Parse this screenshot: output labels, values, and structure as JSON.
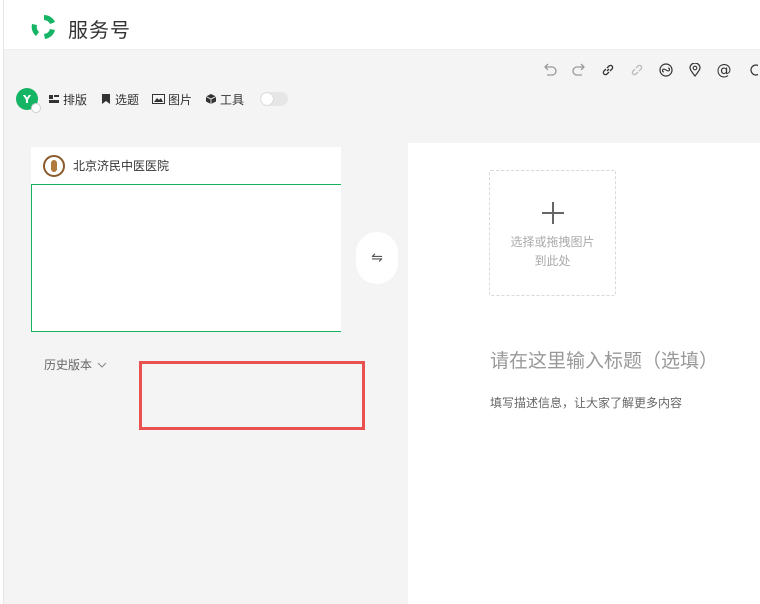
{
  "app": {
    "brand": "服务号",
    "brand_color": "#16b465"
  },
  "toolbar": {
    "icons": [
      "undo-icon",
      "redo-icon",
      "link-icon",
      "unlink-icon",
      "mini-program-icon",
      "location-icon",
      "mention-icon",
      "more-icon"
    ],
    "avatar_letter": "Y",
    "tools": [
      {
        "label": "排版",
        "icon": "layout-icon"
      },
      {
        "label": "选题",
        "icon": "bookmark-icon"
      },
      {
        "label": "图片",
        "icon": "image-icon"
      },
      {
        "label": "工具",
        "icon": "cube-icon"
      }
    ],
    "toggle_on": false
  },
  "preview": {
    "account_name": "北京济民中医医院",
    "border_color": "#15b35e"
  },
  "history": {
    "label": "历史版本"
  },
  "swap": {
    "symbol": "⇋"
  },
  "editor": {
    "cover_line1": "选择或拖拽图片",
    "cover_line2": "到此处",
    "title_placeholder": "请在这里输入标题（选填）",
    "desc_placeholder": "填写描述信息，让大家了解更多内容"
  },
  "annotation": {
    "color": "#e8514f"
  }
}
